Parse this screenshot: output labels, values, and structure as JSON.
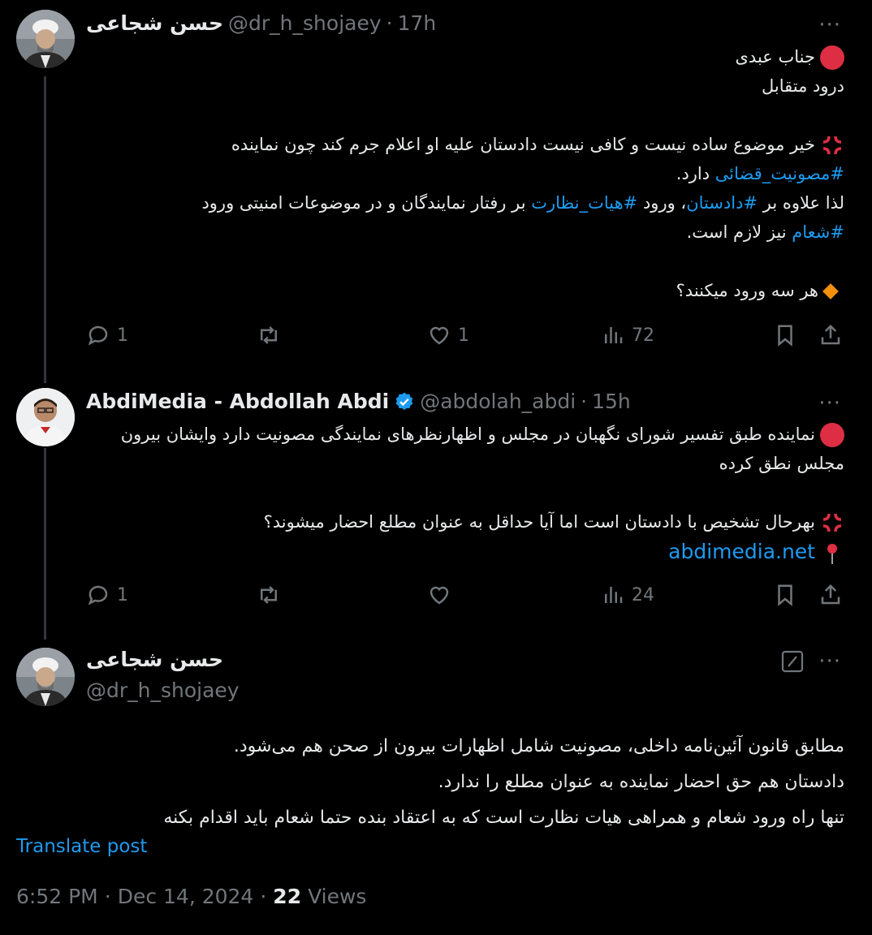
{
  "tweet1": {
    "display_name": "حسن شجاعی",
    "handle": "@dr_h_shojaey",
    "sep": "·",
    "time": "17h",
    "more": "···",
    "line1": "جناب عبدی",
    "line2": "درود متقابل",
    "line3": "خیر موضوع ساده نیست و کافی نیست دادستان علیه او اعلام جرم کند چون نماینده",
    "line4_tag": "#مصونیت_قضائی",
    "line4_rest": " دارد.",
    "line5_a": "لذا علاوه بر ",
    "line5_tag1": "#دادستان",
    "line5_b": "، ورود ",
    "line5_tag2": "#هیات_نظارت",
    "line5_c": " بر رفتار نمایندگان و در موضوعات امنیتی ورود",
    "line6_tag": "#شعام",
    "line6_rest": " نیز لازم است.",
    "line7": "هر سه ورود میکنند؟",
    "replies": "1",
    "retweets": "",
    "likes": "1",
    "views": "72"
  },
  "tweet2": {
    "display_name": "AbdiMedia - Abdollah Abdi",
    "handle": "@abdolah_abdi",
    "sep": "·",
    "time": "15h",
    "more": "···",
    "line1": "نماینده طبق تفسیر شورای نگهبان در مجلس و اظهارنظرهای نمایندگی مصونیت دارد وایشان بیرون",
    "line2": "مجلس نطق کرده",
    "line3": "بهرحال تشخیص با دادستان است اما آیا حداقل به عنوان مطلع احضار میشوند؟",
    "link": "abdimedia.net",
    "replies": "1",
    "retweets": "",
    "likes": "",
    "views": "24"
  },
  "tweet3": {
    "display_name": "حسن شجاعی",
    "handle": "@dr_h_shojaey",
    "more": "···",
    "line1": "مطابق قانون آئین‌نامه داخلی، مصونیت شامل اظهارات بیرون از صحن هم می‌شود.",
    "line2": "دادستان هم حق احضار نماینده به عنوان مطلع را ندارد.",
    "line3": "تنها راه ورود شعام و همراهی هیات نظارت است که به اعتقاد بنده حتما شعام باید اقدام بکنه",
    "translate": "Translate post",
    "time": "6:52 PM",
    "sep": "·",
    "date": "Dec 14, 2024",
    "views_count": "22",
    "views_label": "Views"
  },
  "colors": {
    "accent": "#1d9bf0",
    "muted": "#71767b",
    "text": "#e7e9ea",
    "verified": "#1d9bf0"
  }
}
